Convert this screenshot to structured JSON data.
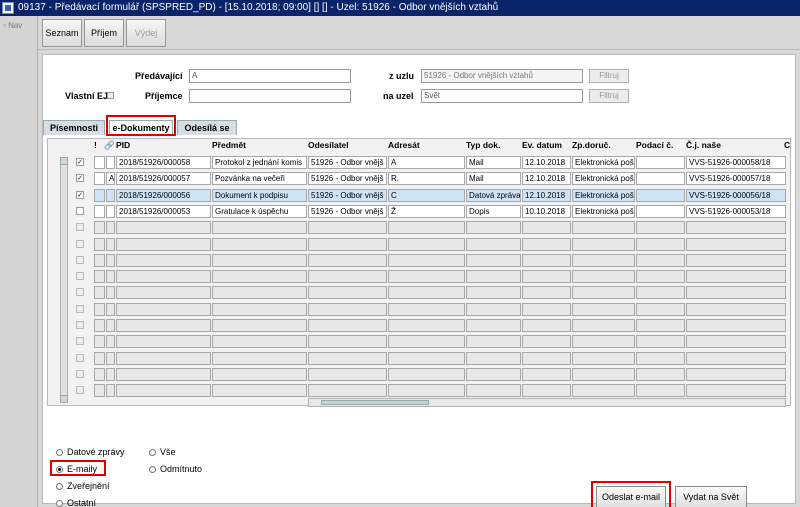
{
  "window": {
    "title": "09137 - Předávací formulář (SPSPRED_PD) - [15.10.2018; 09:00] [] [] - Uzel: 51926 - Odbor vnějších vztahů"
  },
  "left_pane": {
    "nav_label": "Nav"
  },
  "toolbar": {
    "seznam": "Seznam",
    "prijem": "Příjem",
    "vydej": "Výdej"
  },
  "form": {
    "predavajici_label": "Předávající",
    "predavajici_value": "A",
    "z_uzlu_label": "z uzlu",
    "z_uzlu_value": "51926 - Odbor vnějších vztahů",
    "filter1": "Filtruj",
    "vlastni_ej_label": "Vlastní EJ",
    "prijemce_label": "Příjemce",
    "prijemce_value": "",
    "na_uzel_label": "na uzel",
    "na_uzel_value": "Svět",
    "filter2": "Filtruj"
  },
  "tabs": [
    "Písemnosti",
    "e-Dokumenty",
    "Odesílá se"
  ],
  "grid": {
    "headers": {
      "excl": "!",
      "pid": "PID",
      "predmet": "Předmět",
      "odesilatel": "Odesílatel",
      "adresat": "Adresát",
      "typ": "Typ dok.",
      "datum": "Ev. datum",
      "zpdoruc": "Zp.doruč.",
      "podaci": "Podací č.",
      "cj": "Č.j. naše",
      "more": "C"
    },
    "rows": [
      {
        "checked": true,
        "flag": "",
        "pid": "2018/51926/000058",
        "predmet": "Protokol z jednání komis",
        "odesilatel": "51926 - Odbor vnějš",
        "adresat": "A",
        "typ": "Mail",
        "datum": "12.10.2018",
        "zpdoruc": "Elektronická poš",
        "podaci": "",
        "cj": "VVS-51926-000058/18"
      },
      {
        "checked": true,
        "flag": "A",
        "pid": "2018/51926/000057",
        "predmet": "Pozvánka na večeři",
        "odesilatel": "51926 - Odbor vnějš",
        "adresat": "R.",
        "typ": "Mail",
        "datum": "12.10.2018",
        "zpdoruc": "Elektronická poš",
        "podaci": "",
        "cj": "VVS-51926-000057/18"
      },
      {
        "checked": true,
        "flag": "",
        "pid": "2018/51926/000056",
        "predmet": "Dokument k podpisu",
        "odesilatel": "51926 - Odbor vnějš",
        "adresat": "C",
        "typ": "Datová zpráva",
        "datum": "12.10.2018",
        "zpdoruc": "Elektronická poš",
        "podaci": "",
        "cj": "VVS-51926-000056/18"
      },
      {
        "checked": false,
        "flag": "",
        "pid": "2018/51926/000053",
        "predmet": "Gratulace k úspěchu",
        "odesilatel": "51926 - Odbor vnějš",
        "adresat": "Ž",
        "typ": "Dopis",
        "datum": "10.10.2018",
        "zpdoruc": "Elektronická poš",
        "podaci": "",
        "cj": "VVS-51926-000053/18"
      }
    ],
    "empty_rows": 11
  },
  "filters": {
    "datove": "Datové zprávy",
    "emaily": "E-maily",
    "zverejneni": "Zveřejnění",
    "ostatni": "Ostatní",
    "vse": "Vše",
    "odmitnuto": "Odmítnuto",
    "selected": "E-maily"
  },
  "buttons": {
    "odeslat": "Odeslat e-mail",
    "vydat": "Vydat na Svět"
  },
  "colors": {
    "titlebar": "#0a246a",
    "highlight": "#e00000",
    "selected_row": "#cfe3f7"
  }
}
